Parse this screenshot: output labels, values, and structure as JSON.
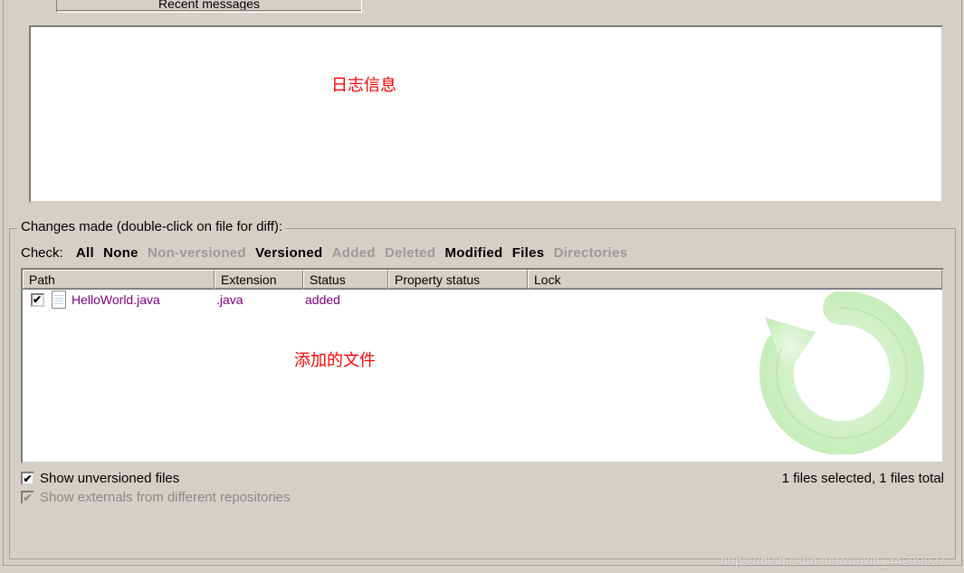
{
  "recent_button": "Recent messages",
  "annotations": {
    "log_info": "日志信息",
    "added_file": "添加的文件"
  },
  "changes_group": {
    "legend": "Changes made (double-click on file for diff):",
    "check_label": "Check:",
    "filters": {
      "all": {
        "label": "All",
        "enabled": true
      },
      "none": {
        "label": "None",
        "enabled": true
      },
      "non_versioned": {
        "label": "Non-versioned",
        "enabled": false
      },
      "versioned": {
        "label": "Versioned",
        "enabled": true
      },
      "added": {
        "label": "Added",
        "enabled": false
      },
      "deleted": {
        "label": "Deleted",
        "enabled": false
      },
      "modified": {
        "label": "Modified",
        "enabled": true
      },
      "files": {
        "label": "Files",
        "enabled": true
      },
      "directories": {
        "label": "Directories",
        "enabled": false
      }
    },
    "columns": {
      "path": "Path",
      "extension": "Extension",
      "status": "Status",
      "property_status": "Property status",
      "lock": "Lock"
    },
    "rows": [
      {
        "checked": true,
        "path": "HelloWorld.java",
        "extension": ".java",
        "status": "added",
        "property_status": "",
        "lock": ""
      }
    ],
    "options": {
      "show_unversioned": {
        "label": "Show unversioned files",
        "checked": true,
        "enabled": true
      },
      "show_externals": {
        "label": "Show externals from different repositories",
        "checked": true,
        "enabled": false
      }
    },
    "status_text": "1 files selected, 1 files total"
  },
  "watermark": "https://blog.csdn.net/weixin_44299027"
}
